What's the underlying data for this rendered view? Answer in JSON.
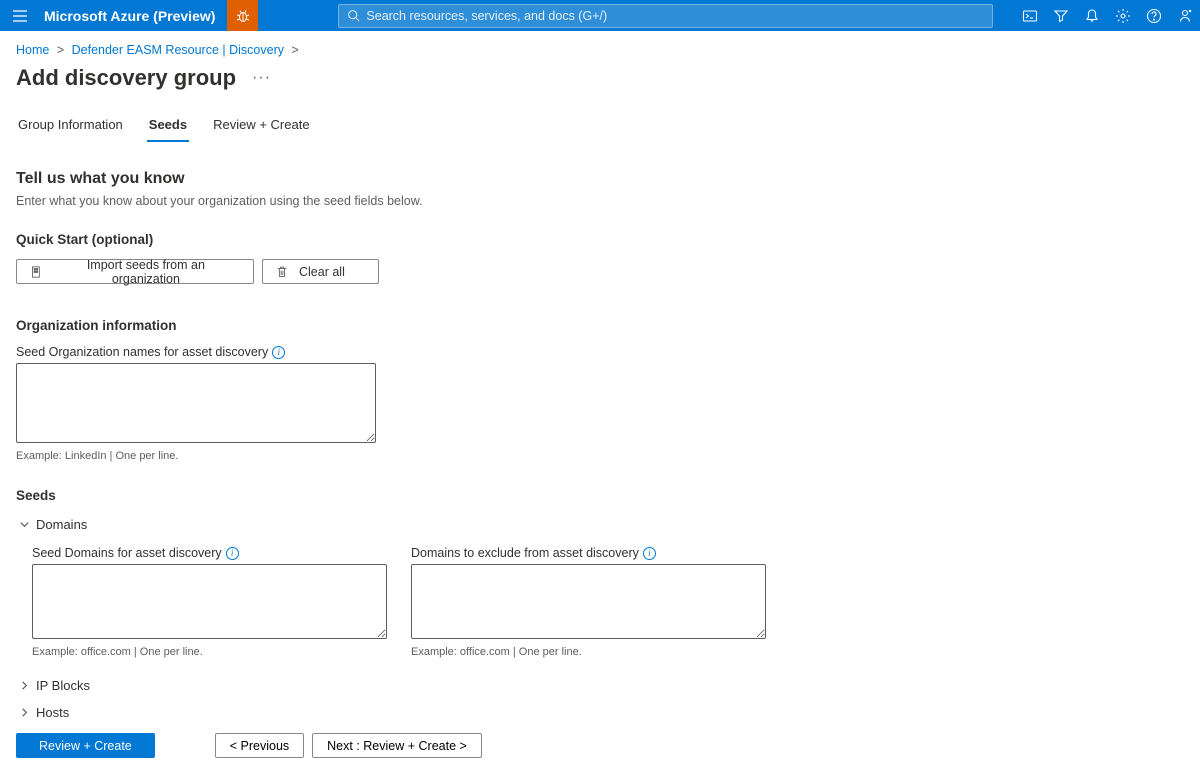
{
  "header": {
    "brand": "Microsoft Azure (Preview)",
    "search_placeholder": "Search resources, services, and docs (G+/)"
  },
  "breadcrumb": {
    "items": [
      "Home",
      "Defender EASM Resource | Discovery"
    ]
  },
  "page": {
    "title": "Add discovery group"
  },
  "tabs": {
    "items": [
      "Group Information",
      "Seeds",
      "Review + Create"
    ],
    "active_index": 1
  },
  "intro": {
    "heading": "Tell us what you know",
    "subtext": "Enter what you know about your organization using the seed fields below."
  },
  "quick_start": {
    "heading": "Quick Start (optional)",
    "import_label": "Import seeds from an organization",
    "clear_label": "Clear all"
  },
  "org": {
    "heading": "Organization information",
    "field_label": "Seed Organization names for asset discovery",
    "field_value": "",
    "help": "Example: LinkedIn | One per line."
  },
  "seeds": {
    "heading": "Seeds",
    "domains": {
      "label": "Domains",
      "seed_label": "Seed Domains for asset discovery",
      "seed_value": "",
      "seed_help": "Example: office.com | One per line.",
      "exclude_label": "Domains to exclude from asset discovery",
      "exclude_value": "",
      "exclude_help": "Example: office.com | One per line."
    },
    "ip_blocks": {
      "label": "IP Blocks"
    },
    "hosts": {
      "label": "Hosts"
    }
  },
  "footer": {
    "review": "Review + Create",
    "previous": "< Previous",
    "next": "Next : Review + Create >"
  }
}
